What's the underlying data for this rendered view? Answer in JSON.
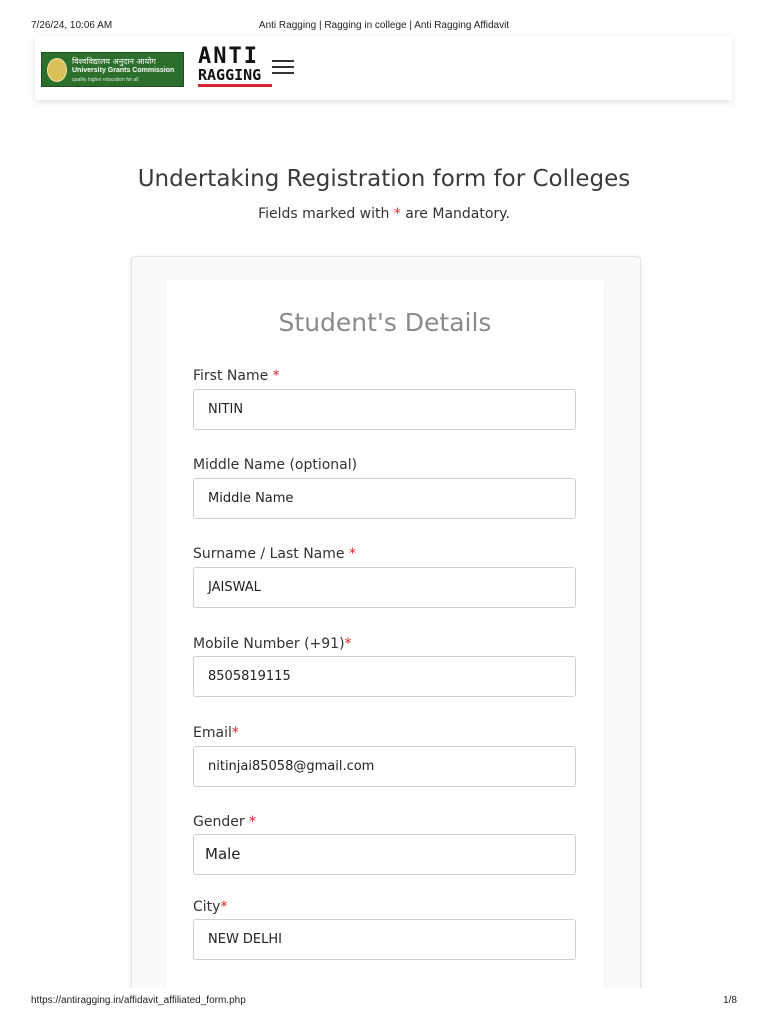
{
  "print": {
    "date": "7/26/24, 10:06 AM",
    "title": "Anti Ragging | Ragging in college | Anti Ragging Affidavit",
    "url": "https://antiragging.in/affidavit_affiliated_form.php",
    "page": "1/8"
  },
  "header": {
    "ugc_logo": {
      "hindi": "विश्वविद्यालय अनुदान आयोग",
      "name": "University Grants Commission",
      "tagline": "quality higher education for all"
    },
    "site_logo": {
      "line1": "ANTI",
      "line2": "RAGGING"
    },
    "menu_icon": "hamburger-icon"
  },
  "page": {
    "heading": "Undertaking Registration form for Colleges",
    "note_before": "Fields marked with ",
    "note_star": "*",
    "note_after": " are Mandatory."
  },
  "form": {
    "section_title": "Student's Details",
    "fields": [
      {
        "label": "First Name ",
        "required": "*",
        "value": "NITIN"
      },
      {
        "label": "Middle Name (optional)",
        "required": "",
        "value": "Middle Name"
      },
      {
        "label": "Surname / Last Name ",
        "required": "*",
        "value": "JAISWAL"
      },
      {
        "label": "Mobile Number (+91)",
        "required": "*",
        "value": "8505819115"
      },
      {
        "label": "Email",
        "required": "*",
        "value": "nitinjai85058@gmail.com"
      },
      {
        "label": "Gender ",
        "required": "*",
        "value": "Male"
      },
      {
        "label": "City",
        "required": "*",
        "value": "NEW DELHI"
      }
    ]
  },
  "colors": {
    "required_star": "#d9232e",
    "ugc_green": "#2c6e2c",
    "logo_red_bar": "#d9232e"
  }
}
